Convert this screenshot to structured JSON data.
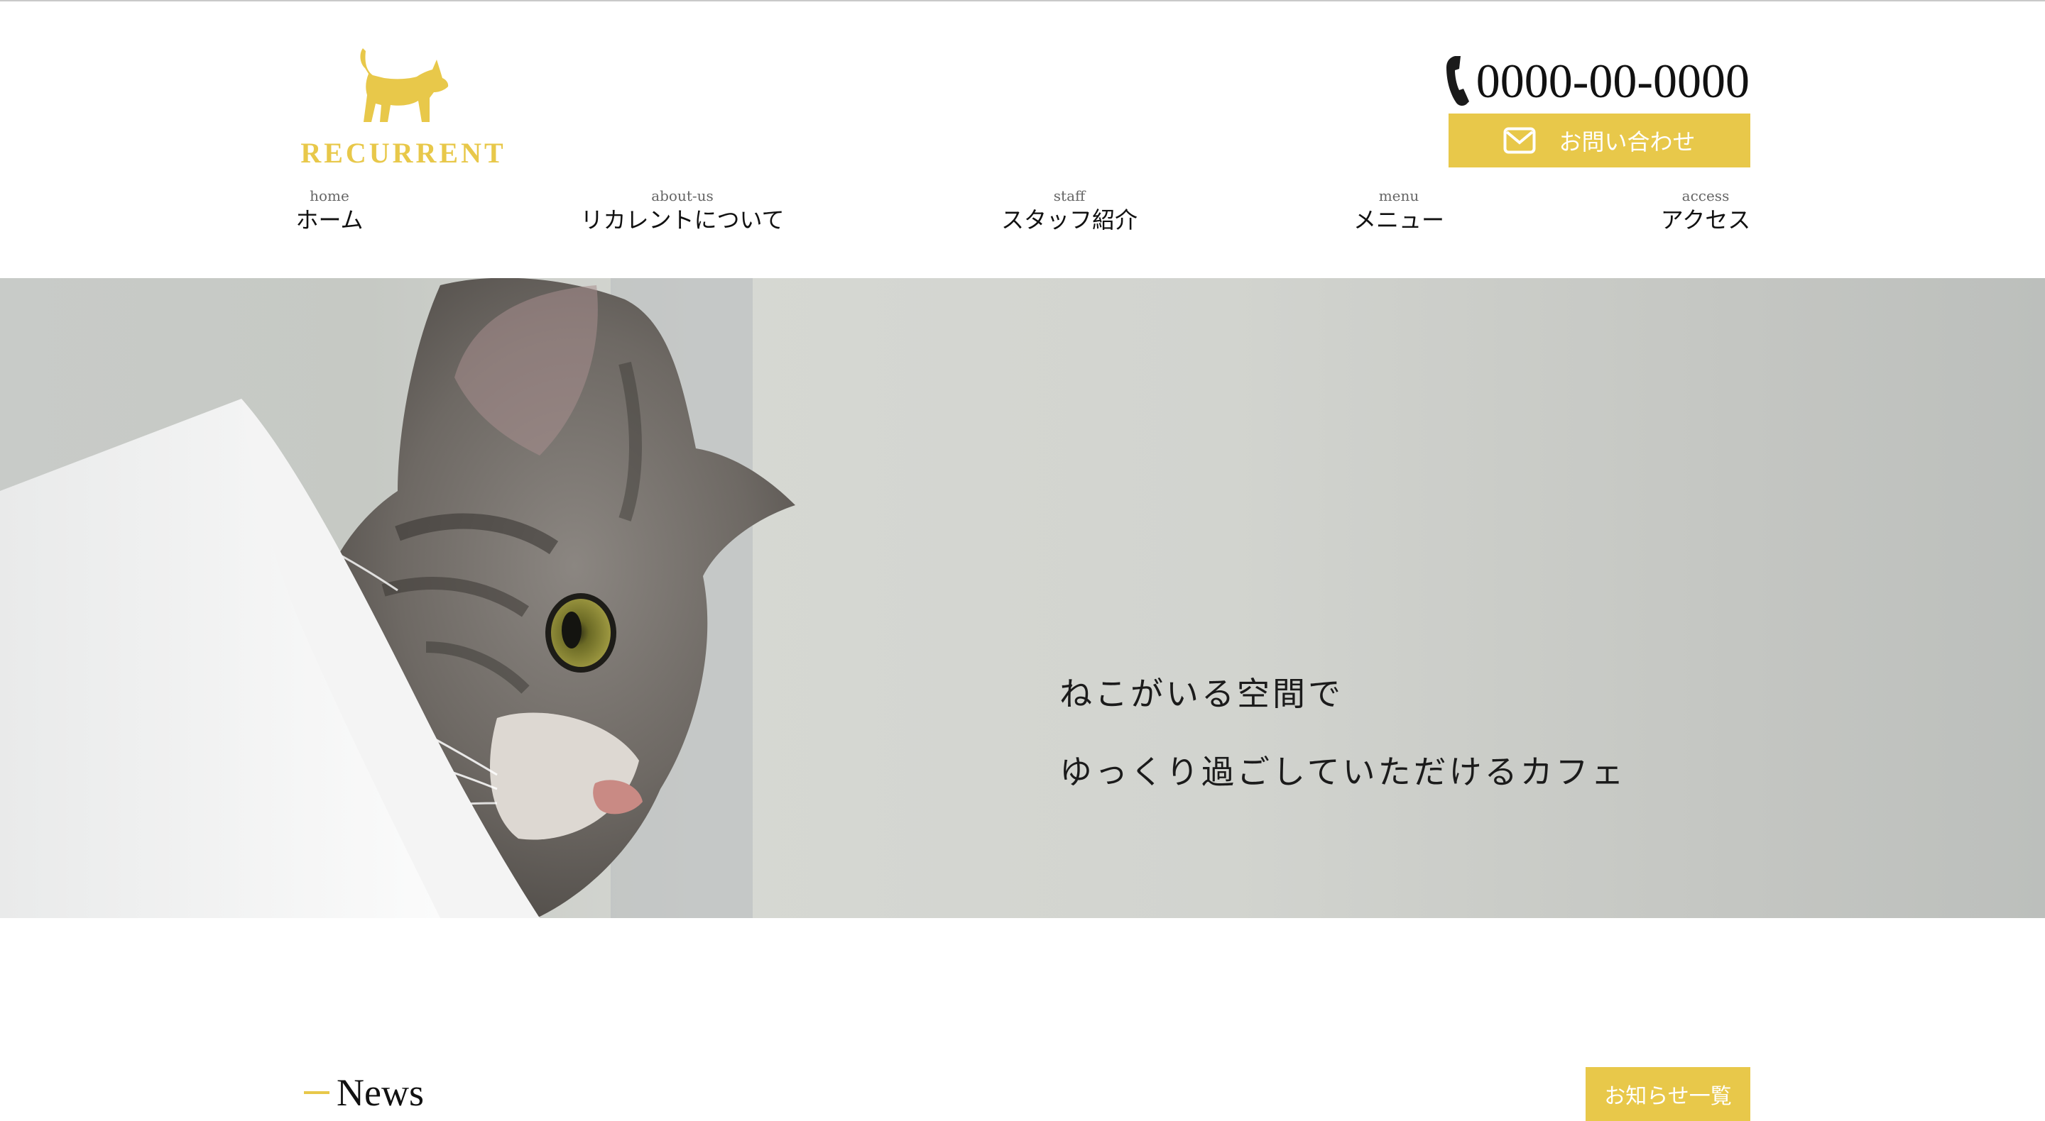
{
  "brand": {
    "name": "RECURRENT",
    "logo_icon": "cat-icon",
    "accent_color": "#e8c84a"
  },
  "header": {
    "phone_icon": "phone-icon",
    "phone_number": "0000-00-0000",
    "contact_button": {
      "label": "お問い合わせ",
      "icon": "mail-icon"
    }
  },
  "nav": {
    "items": [
      {
        "en": "home",
        "ja": "ホーム"
      },
      {
        "en": "about-us",
        "ja": "リカレントについて"
      },
      {
        "en": "staff",
        "ja": "スタッフ紹介"
      },
      {
        "en": "menu",
        "ja": "メニュー"
      },
      {
        "en": "access",
        "ja": "アクセス"
      }
    ]
  },
  "hero": {
    "line1": "ねこがいる空間で",
    "line2": "ゆっくり過ごしていただけるカフェ"
  },
  "news": {
    "title": "News",
    "view_all_label": "お知らせ一覧"
  }
}
